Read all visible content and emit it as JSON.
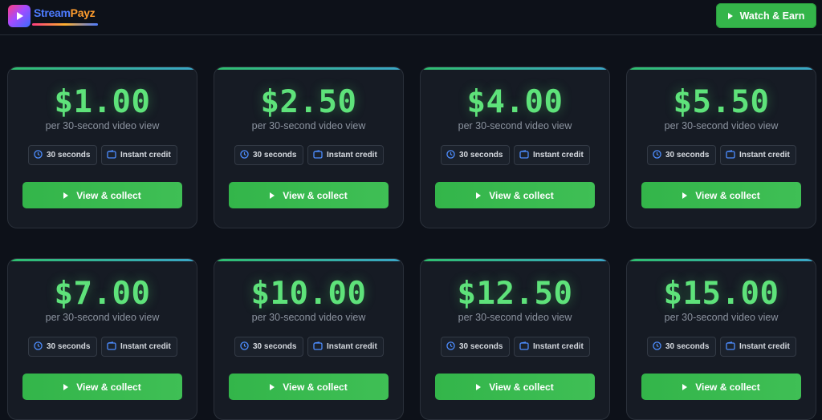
{
  "brand": {
    "name_part1": "Stream",
    "name_part2": "Payz"
  },
  "header": {
    "watch_button_label": "Watch & Earn"
  },
  "colors": {
    "accent_green": "#34b54a",
    "price_green": "#5ee27a",
    "background": "#0d1119",
    "card": "#161b24"
  },
  "cards": [
    {
      "price": "$1.00",
      "subtitle": "per 30-second video view",
      "tag_duration": "30 seconds",
      "tag_credit": "Instant credit",
      "button": "View & collect"
    },
    {
      "price": "$2.50",
      "subtitle": "per 30-second video view",
      "tag_duration": "30 seconds",
      "tag_credit": "Instant credit",
      "button": "View & collect"
    },
    {
      "price": "$4.00",
      "subtitle": "per 30-second video view",
      "tag_duration": "30 seconds",
      "tag_credit": "Instant credit",
      "button": "View & collect"
    },
    {
      "price": "$5.50",
      "subtitle": "per 30-second video view",
      "tag_duration": "30 seconds",
      "tag_credit": "Instant credit",
      "button": "View & collect"
    },
    {
      "price": "$7.00",
      "subtitle": "per 30-second video view",
      "tag_duration": "30 seconds",
      "tag_credit": "Instant credit",
      "button": "View & collect"
    },
    {
      "price": "$10.00",
      "subtitle": "per 30-second video view",
      "tag_duration": "30 seconds",
      "tag_credit": "Instant credit",
      "button": "View & collect"
    },
    {
      "price": "$12.50",
      "subtitle": "per 30-second video view",
      "tag_duration": "30 seconds",
      "tag_credit": "Instant credit",
      "button": "View & collect"
    },
    {
      "price": "$15.00",
      "subtitle": "per 30-second video view",
      "tag_duration": "30 seconds",
      "tag_credit": "Instant credit",
      "button": "View & collect"
    }
  ],
  "icons": {
    "play": "play-icon",
    "clock": "clock-icon",
    "wallet": "wallet-icon",
    "logo": "logo-icon"
  }
}
